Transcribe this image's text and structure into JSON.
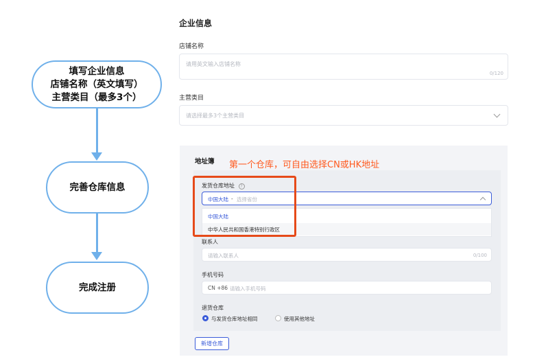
{
  "flowchart": {
    "step1_lines": [
      "填写企业信息",
      "店铺名称（英文填写）",
      "主营类目（最多3个）"
    ],
    "step2": "完善仓库信息",
    "step3": "完成注册"
  },
  "form": {
    "company_section": "企业信息",
    "store_name_label": "店铺名称",
    "store_name_placeholder": "请用英文输入店铺名称",
    "store_name_counter": "0/120",
    "category_label": "主营类目",
    "category_placeholder": "请选择最多3个主营类目",
    "address_section": "地址簿",
    "annotation": "第一个仓库，可自由选择CN或HK地址",
    "warehouse_label": "发货仓库地址",
    "warehouse_selected": "中国大陆",
    "warehouse_separator": "-",
    "warehouse_province_placeholder": "选择省份",
    "dropdown_options": [
      "中国大陆",
      "中华人民共和国香港特别行政区"
    ],
    "contact_label": "联系人",
    "contact_placeholder": "请输入联系人",
    "contact_counter": "0/100",
    "phone_label": "手机号码",
    "phone_prefix": "CN +86",
    "phone_placeholder": "请输入手机号码",
    "return_label": "退货仓库",
    "return_option_same": "与发货仓库地址相同",
    "return_option_other": "使用其他地址",
    "add_warehouse_button": "新增仓库"
  },
  "colors": {
    "flow_blue": "#6fb0ea",
    "annotation_orange": "#ff5a1f",
    "highlight_red": "#e64a19",
    "link_blue": "#3a5bd9"
  }
}
